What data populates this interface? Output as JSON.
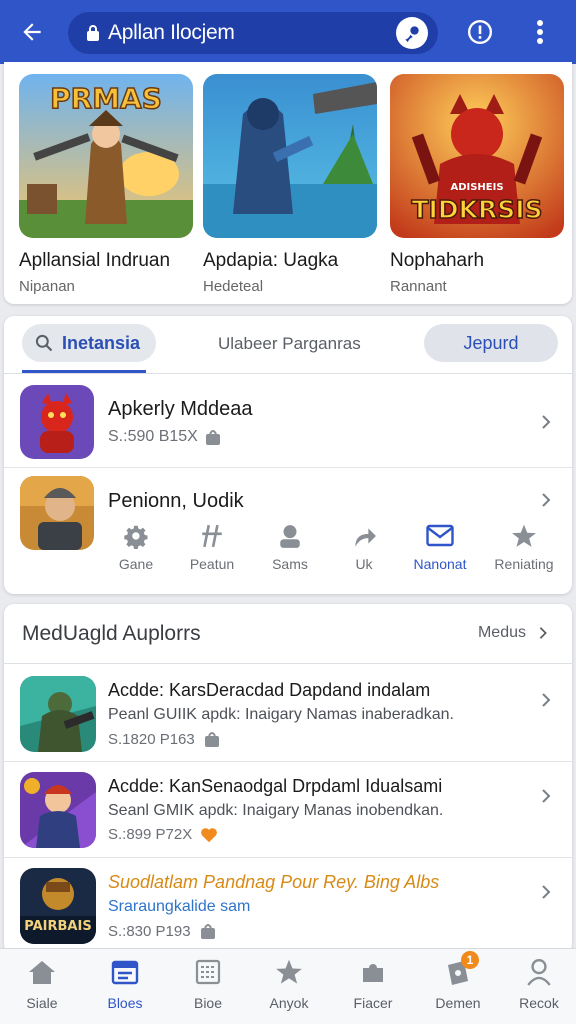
{
  "topbar": {
    "search_text": "Apllan Ilocjem",
    "colors": {
      "bar": "#2f55c9",
      "pill": "#1f3ea8"
    }
  },
  "featured": [
    {
      "title": "Apllansial Indruan",
      "subtitle": "Nipanan",
      "art_text": "PRMAS"
    },
    {
      "title": "Apdapia: Uagka",
      "subtitle": "Hedeteal",
      "art_text": ""
    },
    {
      "title": "Nophaharh",
      "subtitle": "Rannant",
      "art_text": "TIDKRSIS",
      "art_top_text": "ADISHEIS"
    }
  ],
  "tabs": {
    "active": "Inetansia",
    "middle": "Ulabeer Parganras",
    "right": "Jepurd"
  },
  "list": [
    {
      "title": "Apkerly Mddeaa",
      "meta": "S.:590  B15X"
    },
    {
      "title": "Penionn, Uodik",
      "meta": ""
    }
  ],
  "actions": [
    {
      "label": "Gane",
      "icon": "gear-icon"
    },
    {
      "label": "Peatun",
      "icon": "slash-icon"
    },
    {
      "label": "Sams",
      "icon": "person-icon"
    },
    {
      "label": "Uk",
      "icon": "share-arrow-icon"
    },
    {
      "label": "Nanonat",
      "icon": "mail-icon",
      "active": true
    },
    {
      "label": "Reniating",
      "icon": "star-icon"
    }
  ],
  "recommend": {
    "title": "MedUagld Auplorrs",
    "more": "Medus",
    "items": [
      {
        "title": "Acdde: KarsDeracdad Dapdand indalam",
        "desc": "Peanl GUIIK apdk: Inaigary Namas inaberadkan.",
        "meta": "S.1820  P163"
      },
      {
        "title": "Acdde: KanSenaodgal Drpdaml Idualsami",
        "desc": "Seanl GMIK apdk: Inaigary Manas inobendkan.",
        "meta": "S.:899  P72X"
      },
      {
        "title": "Suodlatlam Pandnag Pour Rey. Bing Albs",
        "desc": "Sraraungkalide sam",
        "meta": "S.:830  P193",
        "icon_text": "PAIRBAIS"
      }
    ]
  },
  "bottomnav": [
    {
      "label": "Siale",
      "icon": "home-icon"
    },
    {
      "label": "Bloes",
      "icon": "calendar-icon",
      "active": true
    },
    {
      "label": "Bioe",
      "icon": "grid-icon"
    },
    {
      "label": "Anyok",
      "icon": "star-icon"
    },
    {
      "label": "Fiacer",
      "icon": "puzzle-icon"
    },
    {
      "label": "Demen",
      "icon": "ticket-icon",
      "badge": "1"
    },
    {
      "label": "Recok",
      "icon": "person-icon"
    }
  ]
}
